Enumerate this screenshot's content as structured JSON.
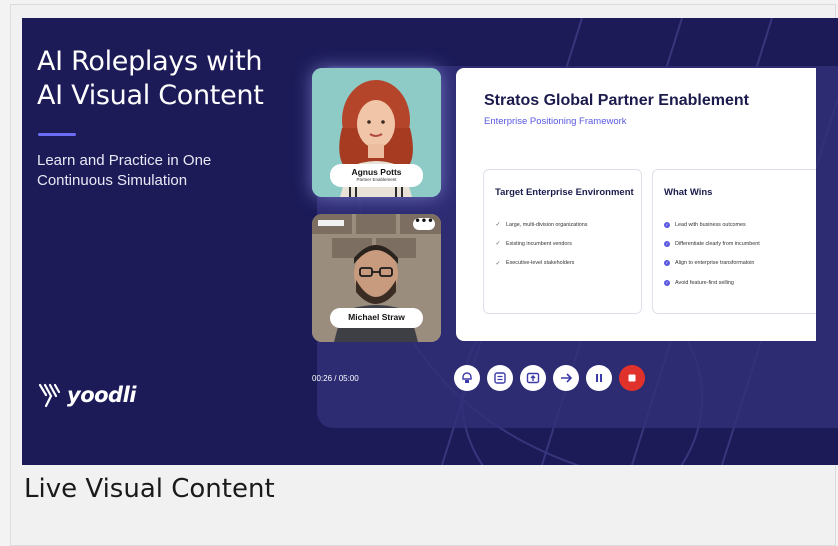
{
  "hero": {
    "headline_line1": "AI Roleplays with",
    "headline_line2": "AI Visual Content",
    "subhead_line1": "Learn and Practice in One",
    "subhead_line2": "Continuous Simulation",
    "logo_text": "yoodli"
  },
  "participants": [
    {
      "name": "Agnus Potts",
      "role": "Partner Enablement"
    },
    {
      "name": "Michael Straw",
      "more_label": "•••"
    }
  ],
  "slide": {
    "title": "Stratos Global Partner Enablement",
    "subtitle": "Enterprise Positioning Framework",
    "panels": [
      {
        "title": "Target Enterprise Environment",
        "items": [
          "Large, multi-division organizations",
          "Existing incumbent vendors",
          "Executive-level stakeholders"
        ]
      },
      {
        "title": "What Wins",
        "items": [
          "Lead with business outcomes",
          "Differentiate clearly from incumbent",
          "Align to enterprise transformatoin",
          "Avoid feature-first selling"
        ]
      }
    ]
  },
  "session": {
    "timer": "00:26 / 05:00",
    "controls": [
      "coach-icon",
      "notes-icon",
      "share-screen-icon",
      "next-icon",
      "pause-icon",
      "stop-icon"
    ]
  },
  "caption": "Live Visual Content",
  "colors": {
    "background": "#1c1b58",
    "accent": "#5a58e0",
    "stop": "#e0322b"
  }
}
